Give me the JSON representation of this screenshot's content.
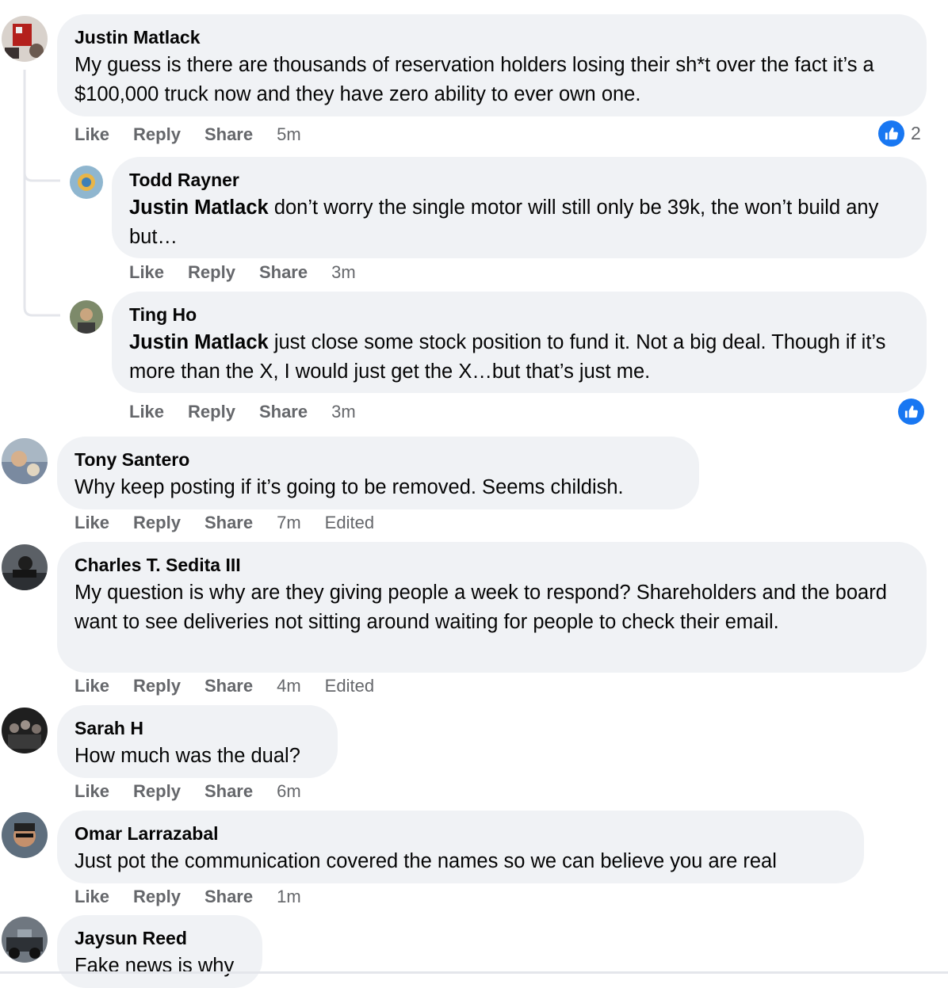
{
  "actions": {
    "like": "Like",
    "reply": "Reply",
    "share": "Share",
    "edited": "Edited"
  },
  "comments": [
    {
      "author": "Justin Matlack",
      "text": "My guess is there are thousands of reservation holders losing their sh*t over the fact it’s a $100,000 truck now and they have zero ability to ever own one.",
      "time": "5m",
      "reaction_count": "2",
      "reaction_icon": "like-thumb-icon",
      "avatar_icon": "user-avatar-photo"
    },
    {
      "author": "Todd Rayner",
      "mention": "Justin Matlack",
      "text": " don’t worry the single motor will still only be 39k, the won’t build any but…",
      "time": "3m",
      "avatar_icon": "user-avatar-photo"
    },
    {
      "author": "Ting Ho",
      "mention": "Justin Matlack",
      "text": " just close some stock position to fund it. Not a big deal. Though if it’s more than the X, I would just get the X…but that’s just me.",
      "time": "3m",
      "reaction_icon": "like-thumb-icon",
      "avatar_icon": "user-avatar-photo"
    },
    {
      "author": "Tony Santero",
      "text": "Why keep posting if it’s going to be removed. Seems childish.",
      "time": "7m",
      "edited": true,
      "avatar_icon": "user-avatar-photo"
    },
    {
      "author": "Charles T. Sedita III",
      "text": "My question is why are they giving people a week to respond? Shareholders and the board want to see deliveries not sitting around waiting for people to check their email.",
      "time": "4m",
      "edited": true,
      "avatar_icon": "user-avatar-photo"
    },
    {
      "author": "Sarah H",
      "text": "How much was the dual?",
      "time": "6m",
      "avatar_icon": "user-avatar-photo"
    },
    {
      "author": "Omar Larrazabal",
      "text": "Just pot the communication covered the names so we can believe you are real",
      "time": "1m",
      "avatar_icon": "user-avatar-photo"
    },
    {
      "author": "Jaysun Reed",
      "text": "Fake news is why",
      "avatar_icon": "user-avatar-photo"
    }
  ],
  "colors": {
    "bubble": "#f0f2f5",
    "like_blue": "#1877f2",
    "meta_gray": "#65676b",
    "thread_line": "#e4e6eb"
  }
}
